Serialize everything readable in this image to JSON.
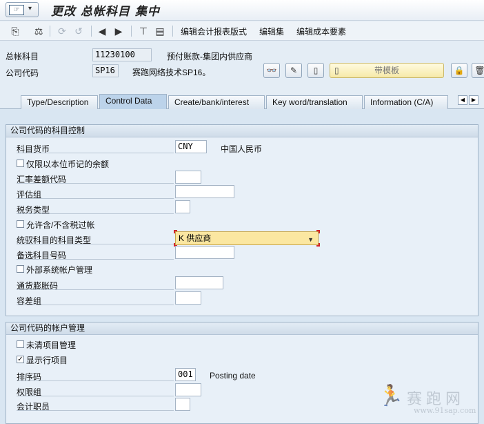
{
  "window": {
    "title": "更改 总帐科目 集中"
  },
  "toolbar": {
    "edit_report_format": "编辑会计报表版式",
    "edit_set": "编辑集",
    "edit_cost_element": "编辑成本要素"
  },
  "header": {
    "gl_account_label": "总帐科目",
    "gl_account_value": "11230100",
    "gl_account_desc": "预付账款-集团内供应商",
    "company_code_label": "公司代码",
    "company_code_value": "SP16",
    "company_code_desc": "赛跑网络技术SP16。",
    "template_button": "带模板"
  },
  "tabs": [
    "Type/Description",
    "Control Data",
    "Create/bank/interest",
    "Key word/translation",
    "Information (C/A)"
  ],
  "section1": {
    "title": "公司代码的科目控制",
    "currency_label": "科目货币",
    "currency_value": "CNY",
    "currency_desc": "中国人民币",
    "only_local_balances": "仅限以本位币记的余额",
    "exchange_rate_diff": "汇率差额代码",
    "valuation_group": "评估组",
    "tax_category": "税务类型",
    "posting_without_tax": "允许含/不含税过帐",
    "recon_account_label": "统驭科目的科目类型",
    "recon_account_value": "K 供应商",
    "alt_account": "备选科目号码",
    "external_mgmt": "外部系统帐户管理",
    "inflation_key": "通货膨胀码",
    "tolerance_group": "容差组"
  },
  "section2": {
    "title": "公司代码的帐户管理",
    "open_item_mgmt": "未清项目管理",
    "line_item_display": "显示行项目",
    "line_item_checked": true,
    "sort_key_label": "排序码",
    "sort_key_value": "001",
    "sort_key_desc": "Posting date",
    "authorization_group": "权限组",
    "accounting_clerk": "会计职员"
  },
  "watermark": {
    "brand": "赛跑网",
    "url": "www.91sap.com"
  }
}
